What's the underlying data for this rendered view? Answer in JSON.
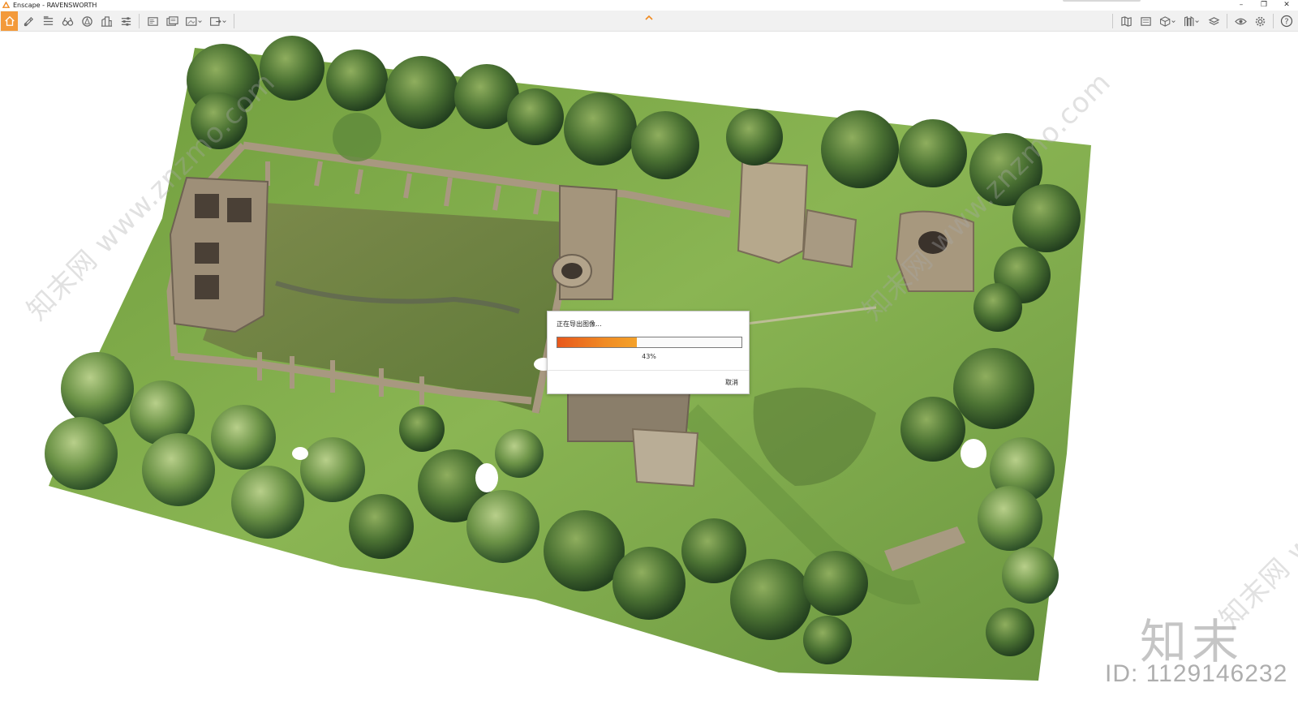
{
  "window": {
    "title": "Enscape - RAVENSWORTH",
    "minimize": "–",
    "restore": "❐",
    "close": "✕"
  },
  "toolbar": {
    "left_items": [
      {
        "name": "home-button",
        "icon": "home-icon"
      },
      {
        "name": "pencil-tool-button",
        "icon": "pencil-icon"
      },
      {
        "name": "bim-button",
        "icon": "bim-list-icon"
      },
      {
        "name": "binoculars-button",
        "icon": "binoculars-icon"
      },
      {
        "name": "compass-button",
        "icon": "compass-icon"
      },
      {
        "name": "building-button",
        "icon": "building-icon"
      },
      {
        "name": "settings-list-button",
        "icon": "sliders-icon"
      },
      {
        "name": "screenshot-button",
        "icon": "screenshot-icon"
      },
      {
        "name": "batch-render-button",
        "icon": "batch-render-icon"
      },
      {
        "name": "video-export-button",
        "icon": "video-export-icon"
      },
      {
        "name": "export-button",
        "icon": "export-icon"
      }
    ],
    "right_items": [
      {
        "name": "map-button",
        "icon": "map-icon"
      },
      {
        "name": "panel-button",
        "icon": "panel-icon"
      },
      {
        "name": "cube-button",
        "icon": "cube-icon"
      },
      {
        "name": "library-button",
        "icon": "library-icon"
      },
      {
        "name": "layers-button",
        "icon": "layers-icon"
      },
      {
        "name": "visibility-button",
        "icon": "eye-icon"
      },
      {
        "name": "settings-button",
        "icon": "gear-icon"
      },
      {
        "name": "help-button",
        "icon": "help-icon",
        "label": "?"
      }
    ],
    "accent_color": "#f39a3a"
  },
  "dialog": {
    "title": "正在导出图像...",
    "progress": 0.43,
    "progress_label": "43%",
    "cancel_label": "取消",
    "progress_colors": [
      "#e8581c",
      "#f4a22a"
    ]
  },
  "watermark": {
    "diagonal_text": "知末网 www.znzmo.com",
    "logo_text": "知末",
    "id_text": "ID: 1129146232"
  }
}
